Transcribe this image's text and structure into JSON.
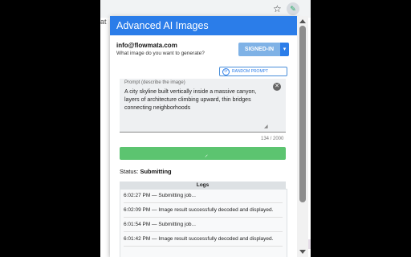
{
  "browser": {
    "star": "☆",
    "extension_icon": "ext-icon",
    "bg_fragment": "at",
    "bg_hort": "hort"
  },
  "popup": {
    "title": "Advanced AI Images",
    "email": "info@flowmata.com",
    "subtext": "What image do you want to generate?",
    "signin_label": "SIGNED-IN",
    "random_prompt_label": "RANDOM PROMPT",
    "prompt_label": "Prompt (describe the image)",
    "prompt_value": "A city skyline built vertically inside a massive canyon, layers of architecture climbing upward, thin bridges connecting neighborhoods",
    "char_counter": "134 / 2000",
    "status_label": "Status:",
    "status_value": "Submitting",
    "logs_title": "Logs",
    "logs": [
      "6:02:27 PM — Submitting job...",
      "6:02:09 PM — Image result successfully decoded and displayed.",
      "6:01:54 PM — Submitting job...",
      "6:01:42 PM — Image result successfully decoded and displayed."
    ]
  },
  "colors": {
    "header": "#2b7de9",
    "progress": "#5cc470",
    "signin_button": "#7fb2e6"
  }
}
